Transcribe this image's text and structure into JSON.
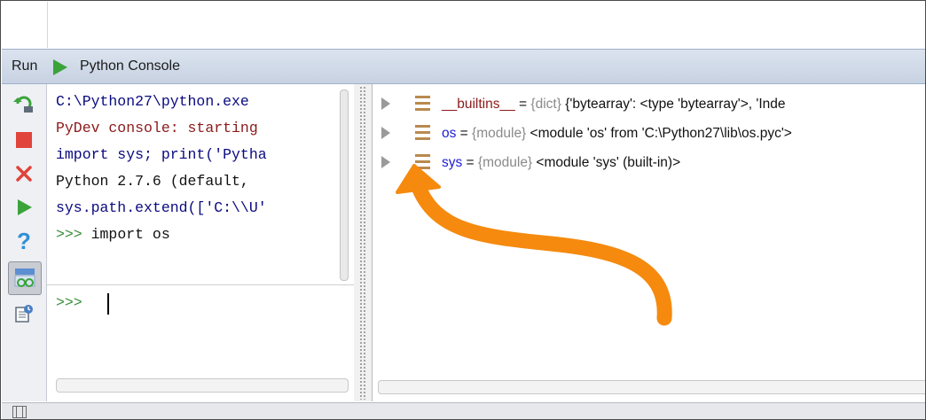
{
  "run_header": {
    "run_label": "Run",
    "console_label": "Python Console"
  },
  "toolbar": {
    "icons": [
      "rerun-icon",
      "stop-icon",
      "close-icon",
      "execute-icon",
      "help-icon",
      "show-variables-icon",
      "history-icon"
    ]
  },
  "console": {
    "lines": [
      {
        "text": "C:\\Python27\\python.exe ",
        "color": "#0a0a80"
      },
      {
        "text": "PyDev console: starting",
        "color": "#8b1a1a"
      },
      {
        "text": "import sys; print('Pytha",
        "color": "#0a0a80"
      },
      {
        "text": "Python 2.7.6 (default, ",
        "color": "#111111"
      },
      {
        "text": "sys.path.extend(['C:\\\\U'",
        "color": "#0a0a80"
      },
      {
        "text": ">>> import os",
        "color": "#111111",
        "prompt": ">>> ",
        "code": "import os"
      }
    ],
    "input_prompt": ">>>"
  },
  "variables": [
    {
      "name": "__builtins__",
      "eq": " = ",
      "type": "{dict}",
      "value": " {'bytearray': <type 'bytearray'>, 'Inde",
      "name_color": "#8b1a1a"
    },
    {
      "name": "os",
      "eq": " = ",
      "type": "{module}",
      "value": " <module 'os' from 'C:\\Python27\\lib\\os.pyc'>",
      "name_color": "#1d1dd6"
    },
    {
      "name": "sys",
      "eq": " = ",
      "type": "{module}",
      "value": " <module 'sys' (built-in)>",
      "name_color": "#1d1dd6"
    }
  ],
  "colors": {
    "annotation_arrow": "#f58a0f",
    "prompt_green": "#3a8e3a"
  }
}
